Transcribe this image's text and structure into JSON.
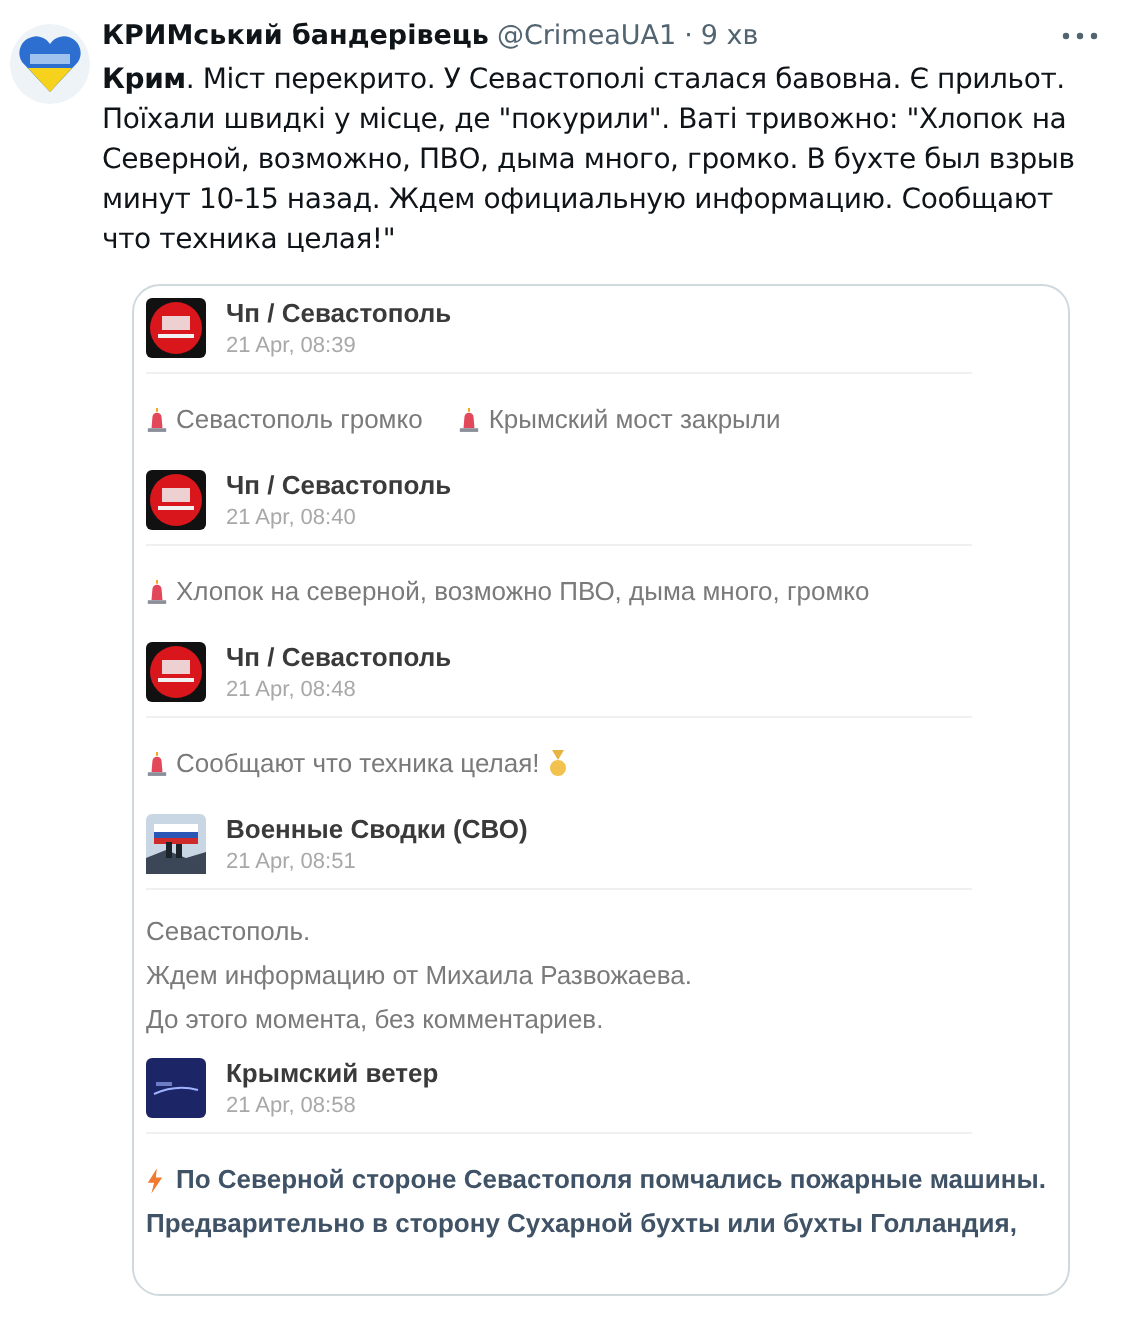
{
  "tweet": {
    "author": "КРИМський бандерівець",
    "handle": "@CrimeaUA1",
    "separator": "·",
    "time": "9 хв",
    "text": "**Крим**. Міст перекрито. У Севастополі сталася бавовна. Є прильот. Поїхали швидкі у місце, де \"покурили\". Ваті тривожно: \"Хлопок на Северной, возможно, ПВО, дыма много, громко. В бухте был взрыв минут 10-15 назад. Ждем официальную информацию. Сообщают что техника целая!\""
  },
  "card": {
    "blocks": [
      {
        "kind": "redheader",
        "channel": "Чп / Севастополь",
        "time": "21 Apr, 08:39"
      },
      {
        "kind": "message",
        "items": [
          {
            "kind": "alert",
            "text": "Севастополь громко"
          },
          {
            "kind": "alert",
            "text": "Крымский мост закрыли"
          }
        ]
      },
      {
        "kind": "redheader",
        "channel": "Чп / Севастополь",
        "time": "21 Apr, 08:40"
      },
      {
        "kind": "message",
        "items": [
          {
            "kind": "alert",
            "text": "Хлопок на северной, возможно ПВО, дыма много, громко"
          }
        ]
      },
      {
        "kind": "redheader",
        "channel": "Чп / Севастополь",
        "time": "21 Apr, 08:48"
      },
      {
        "kind": "message",
        "items": [
          {
            "kind": "alertmedal",
            "text": "Сообщают что техника целая!"
          }
        ]
      },
      {
        "kind": "photoheader",
        "channel": "Военные Сводки (СВО)",
        "time": "21 Apr, 08:51"
      },
      {
        "kind": "lines",
        "lines": [
          "Севастополь.",
          "Ждем информацию от Михаила Развожаева.",
          "До этого момента, без комментариев."
        ]
      },
      {
        "kind": "navyheader",
        "channel": "Крымский ветер",
        "time": "21 Apr, 08:58"
      },
      {
        "kind": "flash",
        "lines": [
          "По Северной стороне Севастополя помчались пожарные машины.",
          "Предварительно в сторону Сухарной бухты или бухты Голландия,"
        ]
      }
    ]
  }
}
